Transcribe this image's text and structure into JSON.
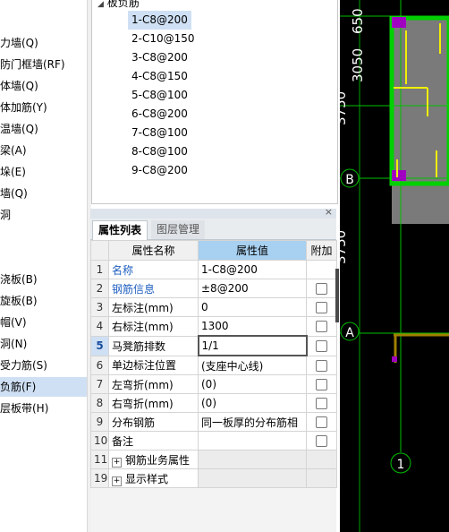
{
  "left_nav": {
    "items": [
      {
        "label": "力墙(Q)",
        "selected": false
      },
      {
        "label": "防门框墙(RF)",
        "selected": false
      },
      {
        "label": "体墙(Q)",
        "selected": false
      },
      {
        "label": "体加筋(Y)",
        "selected": false
      },
      {
        "label": "温墙(Q)",
        "selected": false
      },
      {
        "label": "梁(A)",
        "selected": false
      },
      {
        "label": "垛(E)",
        "selected": false
      },
      {
        "label": "墙(Q)",
        "selected": false
      },
      {
        "label": "洞",
        "selected": false
      },
      {
        "label": "浇板(B)",
        "selected": false
      },
      {
        "label": "旋板(B)",
        "selected": false
      },
      {
        "label": "帽(V)",
        "selected": false
      },
      {
        "label": "洞(N)",
        "selected": false
      },
      {
        "label": "受力筋(S)",
        "selected": false
      },
      {
        "label": "负筋(F)",
        "selected": true
      },
      {
        "label": "层板带(H)",
        "selected": false
      }
    ]
  },
  "tree": {
    "root_label": "板负筋",
    "items": [
      {
        "label": "1-C8@200",
        "selected": true
      },
      {
        "label": "2-C10@150",
        "selected": false
      },
      {
        "label": "3-C8@200",
        "selected": false
      },
      {
        "label": "4-C8@150",
        "selected": false
      },
      {
        "label": "5-C8@100",
        "selected": false
      },
      {
        "label": "6-C8@200",
        "selected": false
      },
      {
        "label": "7-C8@100",
        "selected": false
      },
      {
        "label": "8-C8@100",
        "selected": false
      },
      {
        "label": "9-C8@200",
        "selected": false
      }
    ]
  },
  "properties": {
    "close_glyph": "×",
    "tabs": [
      "属性列表",
      "图层管理"
    ],
    "columns": [
      "属性名称",
      "属性值",
      "附加"
    ],
    "rows": [
      {
        "num": "1",
        "name": "名称",
        "value": "1-C8@200",
        "checkbox": false,
        "blue": true
      },
      {
        "num": "2",
        "name": "钢筋信息",
        "value": "±8@200",
        "checkbox": true,
        "blue": true
      },
      {
        "num": "3",
        "name": "左标注(mm)",
        "value": "0",
        "checkbox": true,
        "blue": false
      },
      {
        "num": "4",
        "name": "右标注(mm)",
        "value": "1300",
        "checkbox": true,
        "blue": false
      },
      {
        "num": "5",
        "name": "马凳筋排数",
        "value": "1/1",
        "checkbox": true,
        "blue": false,
        "selected": true
      },
      {
        "num": "6",
        "name": "单边标注位置",
        "value": "(支座中心线)",
        "checkbox": true,
        "blue": false
      },
      {
        "num": "7",
        "name": "左弯折(mm)",
        "value": "(0)",
        "checkbox": true,
        "blue": false
      },
      {
        "num": "8",
        "name": "右弯折(mm)",
        "value": "(0)",
        "checkbox": true,
        "blue": false
      },
      {
        "num": "9",
        "name": "分布钢筋",
        "value": "同一板厚的分布筋相",
        "checkbox": true,
        "blue": false
      },
      {
        "num": "10",
        "name": "备注",
        "value": "",
        "checkbox": true,
        "blue": false
      },
      {
        "num": "11",
        "name": "钢筋业务属性",
        "value": "",
        "checkbox": false,
        "blue": false,
        "group": true
      },
      {
        "num": "19",
        "name": "显示样式",
        "value": "",
        "checkbox": false,
        "blue": false,
        "group": true
      }
    ]
  },
  "cad": {
    "dim_labels": [
      "650",
      "3050",
      "3750",
      "3750"
    ],
    "axis_labels": [
      "B",
      "A",
      "1"
    ],
    "colors": {
      "background": "#000000",
      "grid": "#00c000",
      "wall": "#7a7a7a",
      "rebar": "#f0f000",
      "accent": "#a000c0",
      "beam": "#a08000"
    }
  }
}
